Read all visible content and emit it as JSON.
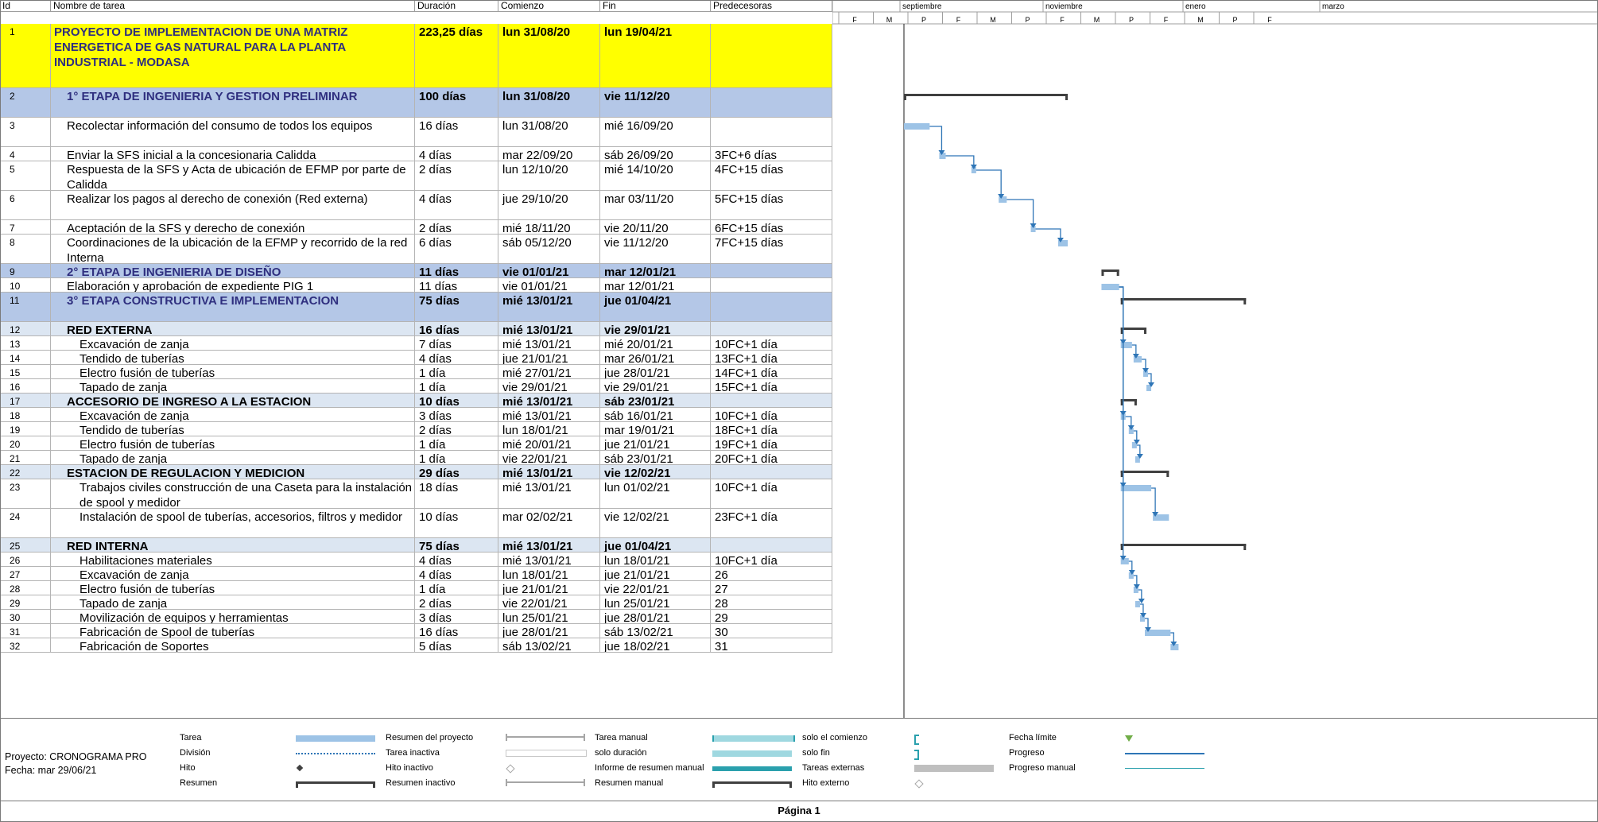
{
  "columns": {
    "id": "Id",
    "name": "Nombre de tarea",
    "duration": "Duración",
    "start": "Comienzo",
    "end": "Fin",
    "predecessors": "Predecesoras"
  },
  "timescale": {
    "top": [
      "septiembre",
      "noviembre",
      "enero",
      "marzo"
    ],
    "bottom": [
      "F",
      "M",
      "P",
      "F",
      "M",
      "P",
      "F",
      "M",
      "P",
      "F",
      "M",
      "P",
      "F"
    ]
  },
  "tasks": [
    {
      "id": "1",
      "name": "PROYECTO DE IMPLEMENTACION DE UNA MATRIZ ENERGETICA DE GAS NATURAL PARA LA PLANTA INDUSTRIAL - MODASA",
      "duration": "223,25 días",
      "start": "lun 31/08/20",
      "end": "lun 19/04/21",
      "pred": "",
      "level": 0
    },
    {
      "id": "2",
      "name": "1° ETAPA DE INGENIERIA Y GESTION PRELIMINAR",
      "duration": "100 días",
      "start": "lun 31/08/20",
      "end": "vie 11/12/20",
      "pred": "",
      "level": 1
    },
    {
      "id": "3",
      "name": "Recolectar información del consumo de todos los equipos",
      "duration": "16 días",
      "start": "lun 31/08/20",
      "end": "mié 16/09/20",
      "pred": "",
      "level": 3
    },
    {
      "id": "4",
      "name": "Enviar la SFS inicial a la concesionaria Calidda",
      "duration": "4 días",
      "start": "mar 22/09/20",
      "end": "sáb 26/09/20",
      "pred": "3FC+6 días",
      "level": 3
    },
    {
      "id": "5",
      "name": "Respuesta de la SFS y Acta de ubicación de EFMP por parte de Calidda",
      "duration": "2 días",
      "start": "lun 12/10/20",
      "end": "mié 14/10/20",
      "pred": "4FC+15 días",
      "level": 3
    },
    {
      "id": "6",
      "name": "Realizar los pagos al derecho de conexión (Red externa)",
      "duration": "4 días",
      "start": "jue 29/10/20",
      "end": "mar 03/11/20",
      "pred": "5FC+15 días",
      "level": 3
    },
    {
      "id": "7",
      "name": "Aceptación de la SFS y derecho de conexión",
      "duration": "2 días",
      "start": "mié 18/11/20",
      "end": "vie 20/11/20",
      "pred": "6FC+15 días",
      "level": 3
    },
    {
      "id": "8",
      "name": "Coordinaciones de la ubicación de la EFMP y recorrido de la red Interna",
      "duration": "6 días",
      "start": "sáb 05/12/20",
      "end": "vie 11/12/20",
      "pred": "7FC+15 días",
      "level": 3
    },
    {
      "id": "9",
      "name": "2° ETAPA DE INGENIERIA DE DISEÑO",
      "duration": "11 días",
      "start": "vie 01/01/21",
      "end": "mar 12/01/21",
      "pred": "",
      "level": 1
    },
    {
      "id": "10",
      "name": "Elaboración y aprobación de expediente PIG 1",
      "duration": "11 días",
      "start": "vie 01/01/21",
      "end": "mar 12/01/21",
      "pred": "",
      "level": 3
    },
    {
      "id": "11",
      "name": "3° ETAPA CONSTRUCTIVA E IMPLEMENTACION",
      "duration": "75 días",
      "start": "mié 13/01/21",
      "end": "jue 01/04/21",
      "pred": "",
      "level": 1
    },
    {
      "id": "12",
      "name": "RED EXTERNA",
      "duration": "16 días",
      "start": "mié 13/01/21",
      "end": "vie 29/01/21",
      "pred": "",
      "level": 2
    },
    {
      "id": "13",
      "name": "Excavación de zanja",
      "duration": "7 días",
      "start": "mié 13/01/21",
      "end": "mié 20/01/21",
      "pred": "10FC+1 día",
      "level": 4
    },
    {
      "id": "14",
      "name": "Tendido de tuberías",
      "duration": "4 días",
      "start": "jue 21/01/21",
      "end": "mar 26/01/21",
      "pred": "13FC+1 día",
      "level": 4
    },
    {
      "id": "15",
      "name": "Electro fusión de tuberías",
      "duration": "1 día",
      "start": "mié 27/01/21",
      "end": "jue 28/01/21",
      "pred": "14FC+1 día",
      "level": 4
    },
    {
      "id": "16",
      "name": "Tapado de zanja",
      "duration": "1 día",
      "start": "vie 29/01/21",
      "end": "vie 29/01/21",
      "pred": "15FC+1 día",
      "level": 4
    },
    {
      "id": "17",
      "name": "ACCESORIO DE INGRESO A LA ESTACION",
      "duration": "10 días",
      "start": "mié 13/01/21",
      "end": "sáb 23/01/21",
      "pred": "",
      "level": 2
    },
    {
      "id": "18",
      "name": "Excavación de zanja",
      "duration": "3 días",
      "start": "mié 13/01/21",
      "end": "sáb 16/01/21",
      "pred": "10FC+1 día",
      "level": 4
    },
    {
      "id": "19",
      "name": "Tendido de tuberías",
      "duration": "2 días",
      "start": "lun 18/01/21",
      "end": "mar 19/01/21",
      "pred": "18FC+1 día",
      "level": 4
    },
    {
      "id": "20",
      "name": "Electro fusión de tuberías",
      "duration": "1 día",
      "start": "mié 20/01/21",
      "end": "jue 21/01/21",
      "pred": "19FC+1 día",
      "level": 4
    },
    {
      "id": "21",
      "name": "Tapado de zanja",
      "duration": "1 día",
      "start": "vie 22/01/21",
      "end": "sáb 23/01/21",
      "pred": "20FC+1 día",
      "level": 4
    },
    {
      "id": "22",
      "name": "ESTACION DE REGULACION Y MEDICION",
      "duration": "29 días",
      "start": "mié 13/01/21",
      "end": "vie 12/02/21",
      "pred": "",
      "level": 2
    },
    {
      "id": "23",
      "name": "Trabajos civiles construcción de una Caseta para la instalación de spool y medidor",
      "duration": "18 días",
      "start": "mié 13/01/21",
      "end": "lun 01/02/21",
      "pred": "10FC+1 día",
      "level": 4
    },
    {
      "id": "24",
      "name": "Instalación de spool de tuberías, accesorios, filtros y medidor",
      "duration": "10 días",
      "start": "mar 02/02/21",
      "end": "vie 12/02/21",
      "pred": "23FC+1 día",
      "level": 4
    },
    {
      "id": "25",
      "name": "RED INTERNA",
      "duration": "75 días",
      "start": "mié 13/01/21",
      "end": "jue 01/04/21",
      "pred": "",
      "level": 2
    },
    {
      "id": "26",
      "name": "Habilitaciones materiales",
      "duration": "4 días",
      "start": "mié 13/01/21",
      "end": "lun 18/01/21",
      "pred": "10FC+1 día",
      "level": 4
    },
    {
      "id": "27",
      "name": "Excavación de zanja",
      "duration": "4 días",
      "start": "lun 18/01/21",
      "end": "jue 21/01/21",
      "pred": "26",
      "level": 4
    },
    {
      "id": "28",
      "name": "Electro fusión de tuberías",
      "duration": "1 día",
      "start": "jue 21/01/21",
      "end": "vie 22/01/21",
      "pred": "27",
      "level": 4
    },
    {
      "id": "29",
      "name": "Tapado de zanja",
      "duration": "2 días",
      "start": "vie 22/01/21",
      "end": "lun 25/01/21",
      "pred": "28",
      "level": 4
    },
    {
      "id": "30",
      "name": "Movilización de equipos y herramientas",
      "duration": "3 días",
      "start": "lun 25/01/21",
      "end": "jue 28/01/21",
      "pred": "29",
      "level": 4
    },
    {
      "id": "31",
      "name": "Fabricación de Spool de tuberías",
      "duration": "16 días",
      "start": "jue 28/01/21",
      "end": "sáb 13/02/21",
      "pred": "30",
      "level": 4
    },
    {
      "id": "32",
      "name": "Fabricación de Soportes",
      "duration": "5 días",
      "start": "sáb 13/02/21",
      "end": "jue 18/02/21",
      "pred": "31",
      "level": 4
    }
  ],
  "legend": {
    "project": "Proyecto: CRONOGRAMA PRO",
    "date": "Fecha: mar 29/06/21",
    "items": [
      {
        "label": "Tarea",
        "symbol": "task"
      },
      {
        "label": "División",
        "symbol": "split"
      },
      {
        "label": "Hito",
        "symbol": "milestone"
      },
      {
        "label": "Resumen",
        "symbol": "summary"
      },
      {
        "label": "Resumen del proyecto",
        "symbol": "project-summary"
      },
      {
        "label": "Tarea inactiva",
        "symbol": "inactive-task"
      },
      {
        "label": "Hito inactivo",
        "symbol": "inactive-milestone"
      },
      {
        "label": "Resumen inactivo",
        "symbol": "inactive-summary"
      },
      {
        "label": "Tarea manual",
        "symbol": "manual-task"
      },
      {
        "label": "solo duración",
        "symbol": "duration-only"
      },
      {
        "label": "Informe de resumen manual",
        "symbol": "manual-summary-rollup"
      },
      {
        "label": "Resumen manual",
        "symbol": "manual-summary"
      },
      {
        "label": "solo el comienzo",
        "symbol": "start-only"
      },
      {
        "label": "solo fin",
        "symbol": "finish-only"
      },
      {
        "label": "Tareas externas",
        "symbol": "external-tasks"
      },
      {
        "label": "Hito externo",
        "symbol": "external-milestone"
      },
      {
        "label": "Fecha límite",
        "symbol": "deadline"
      },
      {
        "label": "Progreso",
        "symbol": "progress"
      },
      {
        "label": "Progreso manual",
        "symbol": "manual-progress"
      }
    ]
  },
  "footer": "Página 1",
  "colors": {
    "task_bar": "#9dc3e6",
    "summary_bar": "#404040",
    "link": "#2e75b6",
    "project_row": "#ffff00",
    "phase_row": "#b4c7e7",
    "group_row": "#dce6f2",
    "manual_task": "#5bb8c4",
    "external_task": "#bfbfbf",
    "deadline_arrow": "#70ad47"
  }
}
